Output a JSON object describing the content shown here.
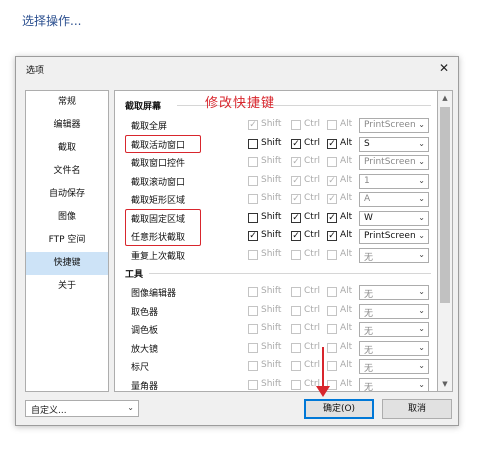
{
  "caption": "选择操作...",
  "dialog": {
    "title": "选项",
    "close_glyph": "✕"
  },
  "sidebar": {
    "items": [
      "常规",
      "编辑器",
      "截取",
      "文件名",
      "自动保存",
      "图像",
      "FTP 空间",
      "快捷键",
      "关于"
    ],
    "selected_index": 7
  },
  "sections": {
    "capture_header": "截取屏幕",
    "tools_header": "工具",
    "annotation": "修改快捷键"
  },
  "modifiers": [
    "Shift",
    "Ctrl",
    "Alt"
  ],
  "capture_rows": [
    {
      "label": "截取全屏",
      "enabled": false,
      "shift": true,
      "ctrl": false,
      "alt": false,
      "key": "PrintScreen"
    },
    {
      "label": "截取活动窗口",
      "enabled": true,
      "shift": false,
      "ctrl": true,
      "alt": true,
      "key": "S"
    },
    {
      "label": "截取窗口控件",
      "enabled": false,
      "shift": false,
      "ctrl": true,
      "alt": false,
      "key": "PrintScreen"
    },
    {
      "label": "截取滚动窗口",
      "enabled": false,
      "shift": false,
      "ctrl": true,
      "alt": true,
      "key": "1"
    },
    {
      "label": "截取矩形区域",
      "enabled": false,
      "shift": false,
      "ctrl": true,
      "alt": true,
      "key": "A"
    },
    {
      "label": "截取固定区域",
      "enabled": true,
      "shift": false,
      "ctrl": true,
      "alt": true,
      "key": "W"
    },
    {
      "label": "任意形状截取",
      "enabled": true,
      "shift": true,
      "ctrl": true,
      "alt": true,
      "key": "PrintScreen"
    },
    {
      "label": "重复上次截取",
      "enabled": false,
      "shift": false,
      "ctrl": false,
      "alt": false,
      "key": "无"
    }
  ],
  "tool_rows": [
    {
      "label": "图像编辑器",
      "enabled": false,
      "shift": false,
      "ctrl": false,
      "alt": false,
      "key": "无"
    },
    {
      "label": "取色器",
      "enabled": false,
      "shift": false,
      "ctrl": false,
      "alt": false,
      "key": "无"
    },
    {
      "label": "调色板",
      "enabled": false,
      "shift": false,
      "ctrl": false,
      "alt": false,
      "key": "无"
    },
    {
      "label": "放大镜",
      "enabled": false,
      "shift": false,
      "ctrl": false,
      "alt": false,
      "key": "无"
    },
    {
      "label": "标尺",
      "enabled": false,
      "shift": false,
      "ctrl": false,
      "alt": false,
      "key": "无"
    },
    {
      "label": "量角器",
      "enabled": false,
      "shift": false,
      "ctrl": false,
      "alt": false,
      "key": "无"
    }
  ],
  "highlighted_rows": [
    "截取活动窗口",
    "截取固定区域",
    "任意形状截取"
  ],
  "footer": {
    "combo_value": "自定义...",
    "ok_label": "确定(O)",
    "cancel_label": "取消"
  },
  "colors": {
    "annotation_red": "#d8262d",
    "selection_blue": "#cde3f7",
    "focus_blue": "#0078d7"
  }
}
